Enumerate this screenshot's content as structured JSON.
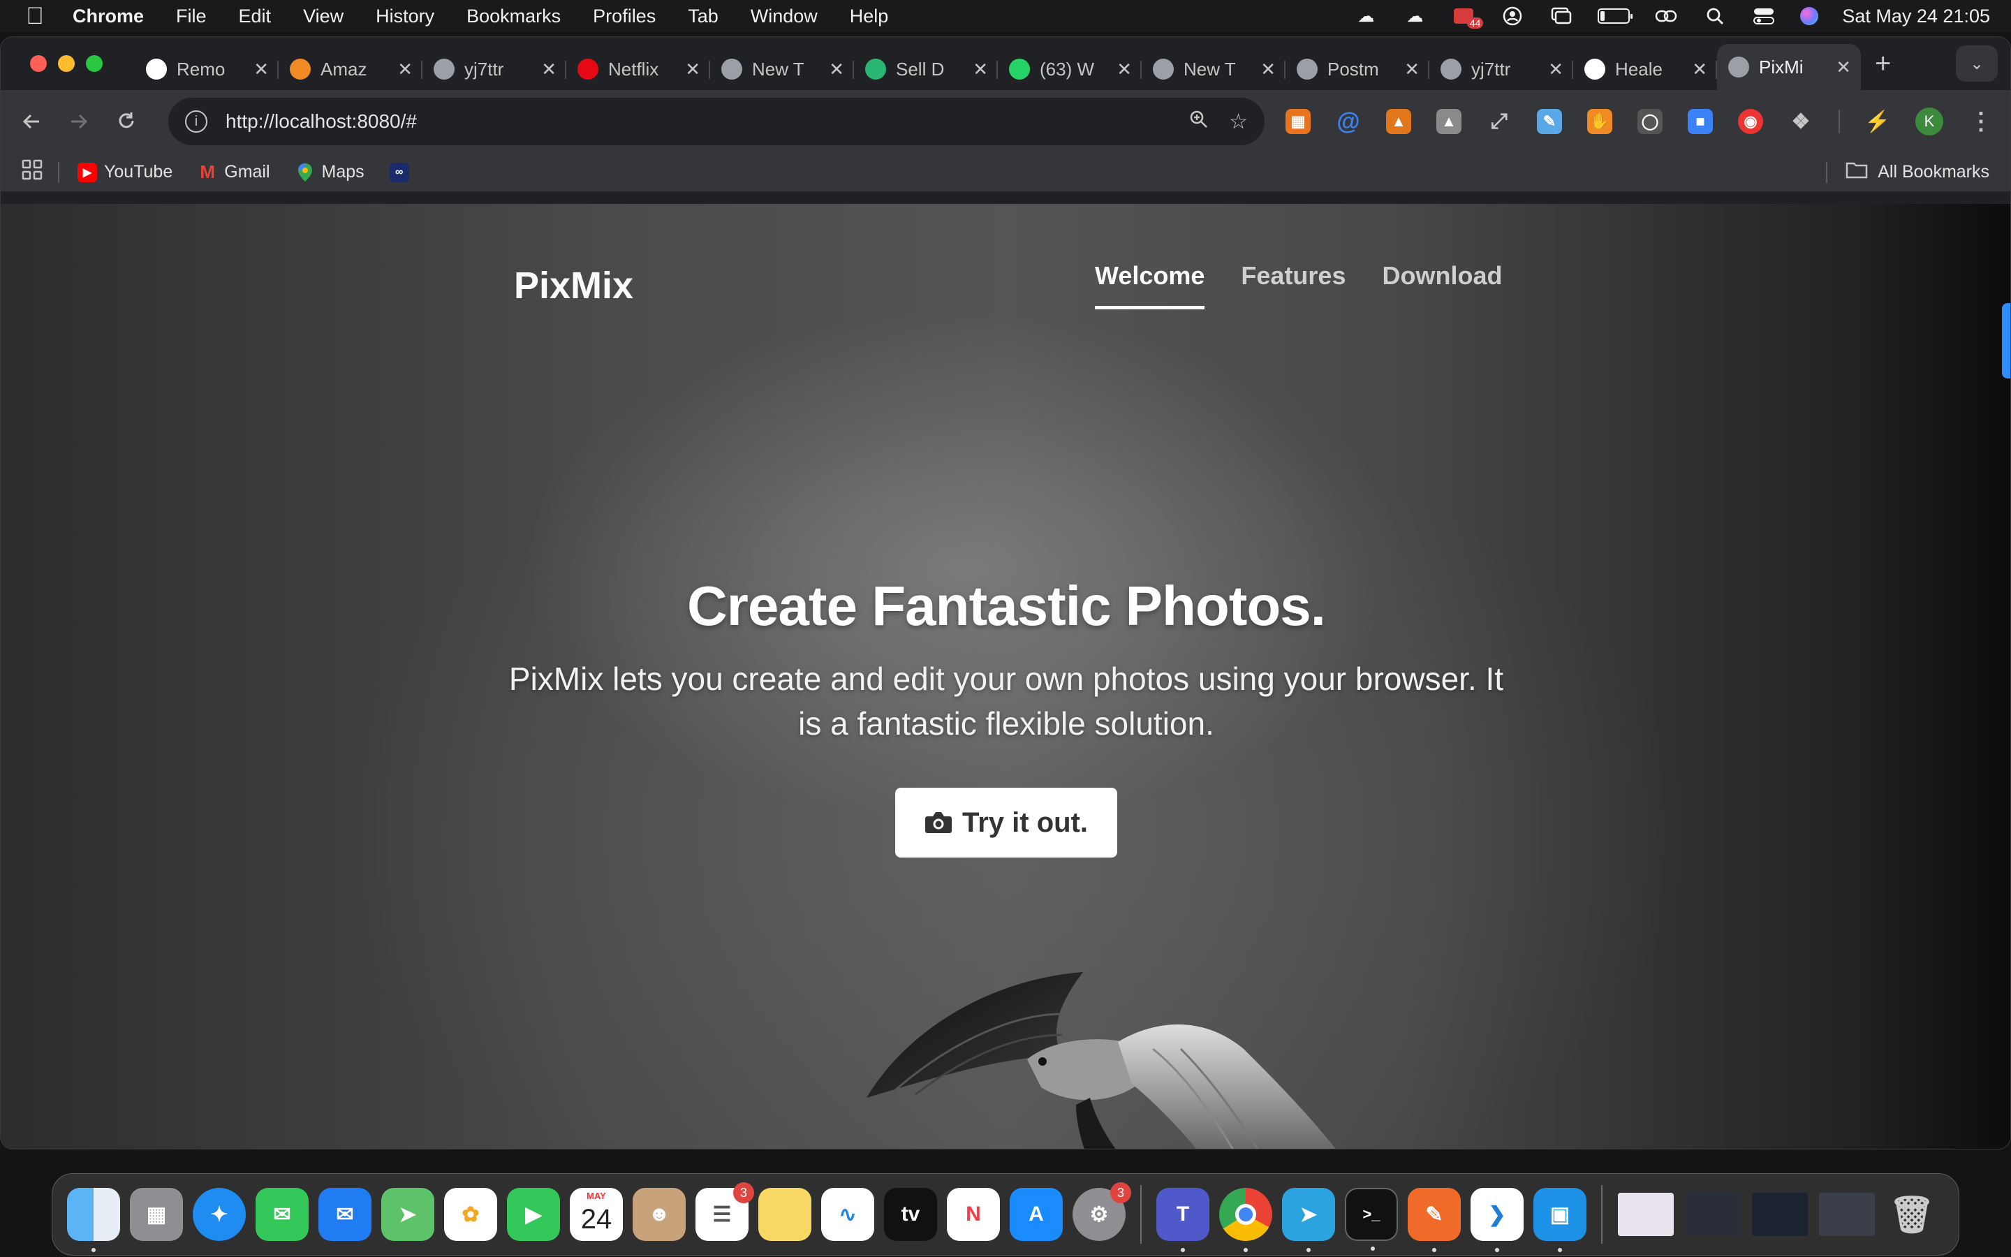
{
  "menubar": {
    "app_name": "Chrome",
    "menus": [
      "File",
      "Edit",
      "View",
      "History",
      "Bookmarks",
      "Profiles",
      "Tab",
      "Window",
      "Help"
    ],
    "badge_count": "44",
    "clock": "Sat May 24  21:05"
  },
  "tabs": [
    {
      "title": "Remo",
      "icon": "openai-icon",
      "color": "#ffffff"
    },
    {
      "title": "Amaz",
      "icon": "amazon-box-icon",
      "color": "#f08a24"
    },
    {
      "title": "yj7ttr",
      "icon": "globe-icon",
      "color": "#9aa0a6"
    },
    {
      "title": "Netflix",
      "icon": "netflix-icon",
      "color": "#e50914"
    },
    {
      "title": "New T",
      "icon": "chrome-icon",
      "color": "#9aa0a6"
    },
    {
      "title": "Sell D",
      "icon": "sell-icon",
      "color": "#2bb673"
    },
    {
      "title": "(63) W",
      "icon": "whatsapp-icon",
      "color": "#25d366"
    },
    {
      "title": "New T",
      "icon": "chrome-icon",
      "color": "#9aa0a6"
    },
    {
      "title": "Postm",
      "icon": "globe-icon",
      "color": "#9aa0a6"
    },
    {
      "title": "yj7ttr",
      "icon": "globe-icon",
      "color": "#9aa0a6"
    },
    {
      "title": "Heale",
      "icon": "github-icon",
      "color": "#ffffff"
    },
    {
      "title": "PixMi",
      "icon": "globe-icon",
      "color": "#9aa0a6",
      "active": true
    }
  ],
  "address_bar": {
    "url": "http://localhost:8080/#"
  },
  "bookmarks": {
    "items": [
      {
        "label": "YouTube",
        "icon": "youtube-icon",
        "color": "#ff0000"
      },
      {
        "label": "Gmail",
        "icon": "gmail-icon",
        "color": "#ea4335"
      },
      {
        "label": "Maps",
        "icon": "maps-pin-icon",
        "color": "#34a853"
      }
    ],
    "all_bookmarks": "All Bookmarks"
  },
  "profile_initial": "K",
  "page": {
    "brand": "PixMix",
    "nav": [
      "Welcome",
      "Features",
      "Download"
    ],
    "active_nav": "Welcome",
    "hero_title": "Create Fantastic Photos.",
    "hero_text": "PixMix lets you create and edit your own photos using your browser. It is a fantastic flexible solution.",
    "cta_label": "Try it out."
  },
  "dock": {
    "calendar_month": "MAY",
    "calendar_day": "24",
    "reminders_badge": "3",
    "settings_badge": "3"
  }
}
